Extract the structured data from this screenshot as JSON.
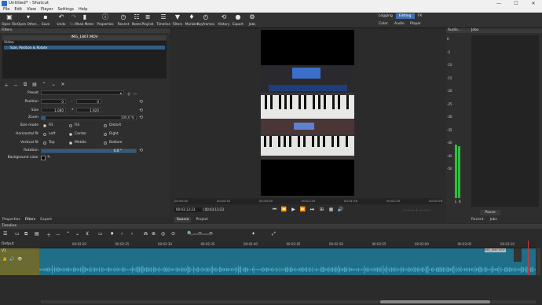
{
  "window": {
    "title": "Untitled* - Shotcut",
    "min": "—",
    "max": "☐",
    "close": "✕"
  },
  "menu": [
    "File",
    "Edit",
    "View",
    "Player",
    "Settings",
    "Help"
  ],
  "toolbar": [
    {
      "label": "Open File",
      "icon": "▣",
      "name": "open-file"
    },
    {
      "label": "Open Other...",
      "icon": "▾",
      "name": "open-other"
    },
    {
      "label": "Save",
      "icon": "▪",
      "name": "save"
    },
    {
      "label": "Undo",
      "icon": "↶",
      "name": "undo"
    },
    {
      "label": "Redo",
      "icon": "↷",
      "name": "redo",
      "disabled": true
    },
    {
      "label": "Peak Meter",
      "icon": "▮",
      "name": "peak-meter"
    },
    {
      "label": "Properties",
      "icon": "ⓘ",
      "name": "properties"
    },
    {
      "label": "Recent",
      "icon": "◷",
      "name": "recent"
    },
    {
      "label": "Notes",
      "icon": "☷",
      "name": "notes"
    },
    {
      "label": "Playlist",
      "icon": "≣",
      "name": "playlist"
    },
    {
      "label": "Timeline",
      "icon": "☰",
      "name": "timeline"
    },
    {
      "label": "Filters",
      "icon": "▼",
      "name": "filters"
    },
    {
      "label": "Markers",
      "icon": "♦",
      "name": "markers"
    },
    {
      "label": "Keyframes",
      "icon": "◴",
      "name": "keyframes"
    },
    {
      "label": "History",
      "icon": "⟲",
      "name": "history"
    },
    {
      "label": "Export",
      "icon": "●",
      "name": "export"
    },
    {
      "label": "Jobs",
      "icon": "⚙",
      "name": "jobs"
    }
  ],
  "layouts": {
    "row1": [
      "Logging",
      "Editing",
      "FX"
    ],
    "active": "Editing",
    "row2": [
      "Color",
      "Audio",
      "Player"
    ]
  },
  "filters": {
    "title": "Filters",
    "clip": "IMG_1867.MOV",
    "category": "Video",
    "item": "Size, Position & Rotate",
    "preset_label": "Preset",
    "position_label": "Position",
    "position_x": "0",
    "position_y": "0",
    "size_label": "Size",
    "size_w": "1,080",
    "size_h": "1,920",
    "zoom_label": "Zoom",
    "zoom_value": "100,0 %",
    "zoom_fraction": 1.0,
    "sizemode_label": "Size mode",
    "sizemode": [
      "Fit",
      "Fill",
      "Distort"
    ],
    "hfit_label": "Horizontal fit",
    "hfit": [
      "Left",
      "Center",
      "Right"
    ],
    "vfit_label": "Vertical fit",
    "vfit": [
      "Top",
      "Middle",
      "Bottom"
    ],
    "rotation_label": "Rotation",
    "rotation_value": "0,0 °",
    "bg_label": "Background color",
    "tabs": [
      "Properties",
      "Filters",
      "Export"
    ]
  },
  "player": {
    "ruler": [
      "00:00:00",
      "00:00:30",
      "00:00:59",
      "00:01:29",
      "00:01:59",
      "00:02:29",
      "00:02:59"
    ],
    "timecode_current": "00:03:13:23",
    "timecode_total": "/ 00:03:13:23",
    "transport": [
      "⏮",
      "⏪",
      "▶",
      "⏩",
      "⏭",
      "⊞",
      "▦",
      "🔊"
    ],
    "inout": "--:--:--:-- / --:--:--:--",
    "tabs": [
      "Source",
      "Project"
    ]
  },
  "audio": {
    "title": "Audio...",
    "ticks": [
      "0",
      "-5",
      "-10",
      "-15",
      "-20",
      "-25",
      "-30",
      "-35",
      "-40",
      "-45",
      "-50"
    ],
    "channels": [
      "L",
      "R"
    ]
  },
  "jobs": {
    "title": "Jobs",
    "pause": "Pause",
    "tabs": [
      "Recent",
      "Jobs"
    ]
  },
  "timeline": {
    "title": "Timeline",
    "output": "Output",
    "track": "V1",
    "ruler": [
      "00:02:20",
      "00:02:25",
      "00:02:30",
      "00:02:35",
      "00:02:40",
      "00:02:45",
      "00:02:50",
      "00:02:55",
      "00:03:00",
      "00:03:05",
      "00:03:10"
    ],
    "clip_label": "IMG_1867.MOV",
    "tools": [
      "☰",
      "▭",
      "⧉",
      "▤",
      "＋",
      "－",
      "⌃",
      "⌄",
      "⊻",
      "▭",
      "♦",
      "‹",
      "›",
      "⋒",
      "⊗",
      "◎",
      "⊙",
      "🔍",
      "⊝",
      "⊕",
      "✦",
      "⤢"
    ]
  }
}
